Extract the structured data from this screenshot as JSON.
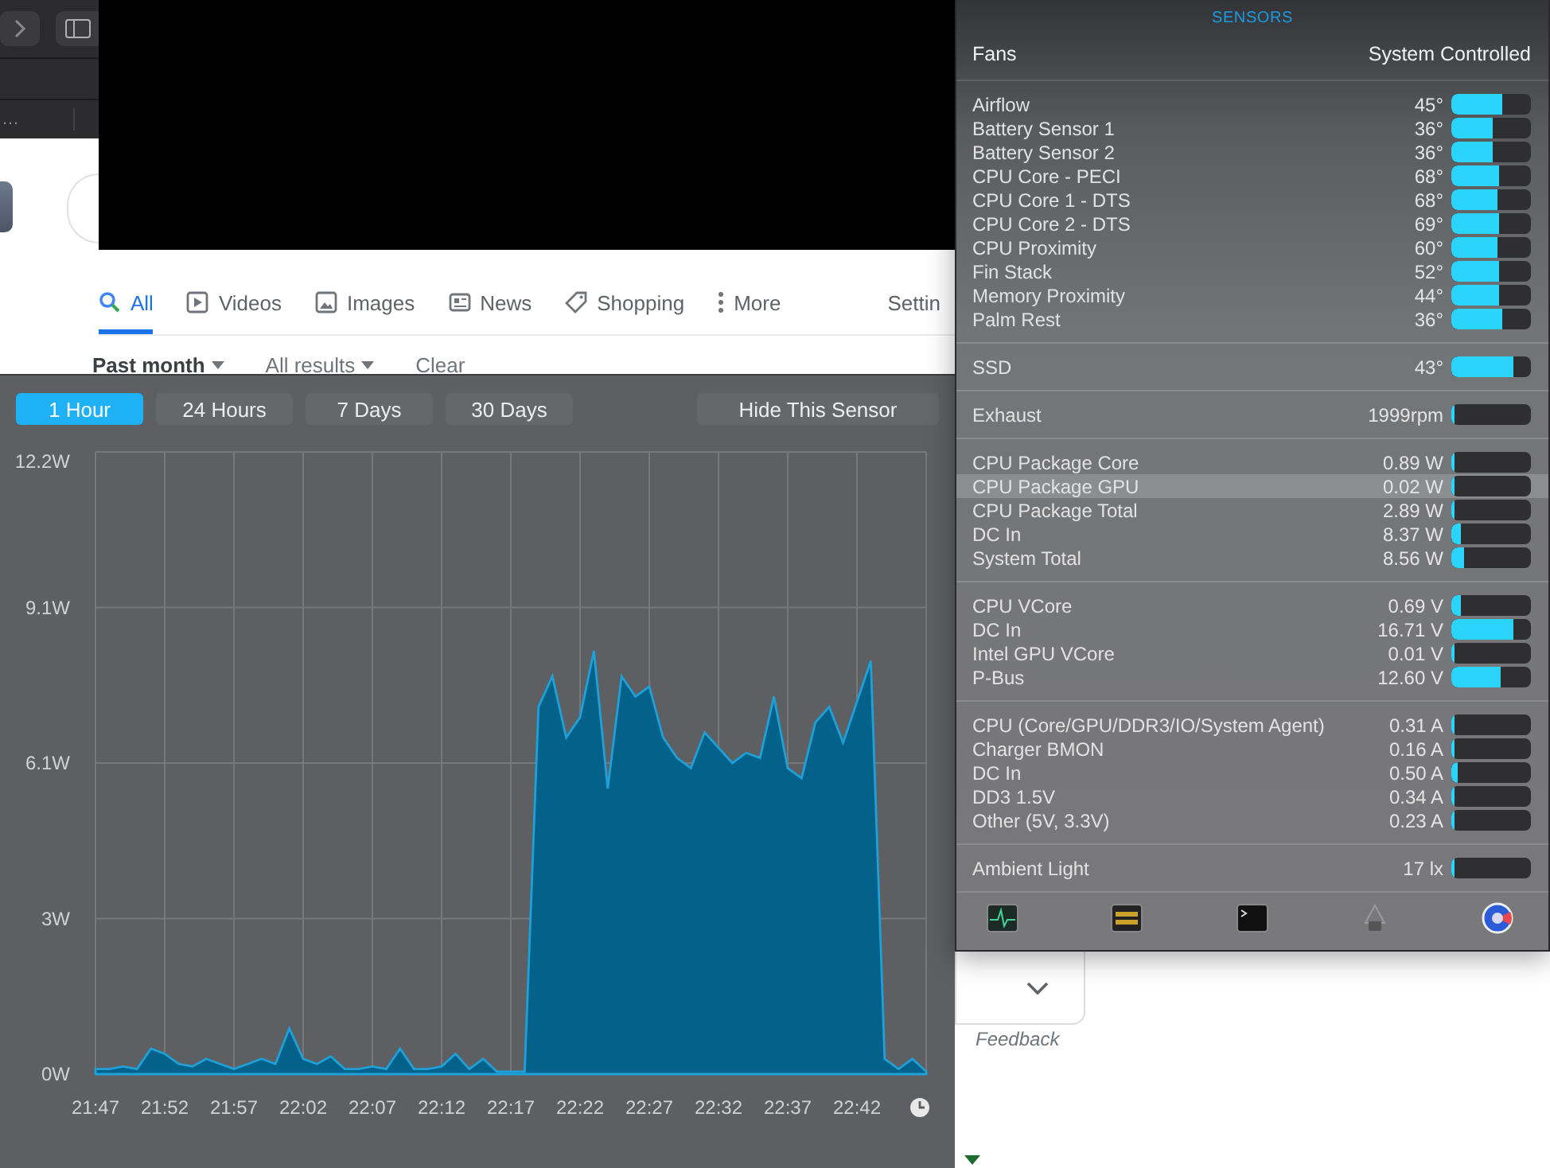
{
  "browser": {
    "tab_title": "…",
    "nav_tabs": [
      {
        "label": "All",
        "selected": true
      },
      {
        "label": "Videos",
        "selected": false
      },
      {
        "label": "Images",
        "selected": false
      },
      {
        "label": "News",
        "selected": false
      },
      {
        "label": "Shopping",
        "selected": false
      },
      {
        "label": "More",
        "selected": false
      },
      {
        "label": "Settin",
        "selected": false
      }
    ],
    "filters": [
      "Past month",
      "All results",
      "Clear"
    ],
    "feedback": "Feedback"
  },
  "history": {
    "ranges": [
      {
        "label": "1 Hour",
        "selected": true
      },
      {
        "label": "24 Hours",
        "selected": false
      },
      {
        "label": "7 Days",
        "selected": false
      },
      {
        "label": "30 Days",
        "selected": false
      }
    ],
    "hide_button": "Hide This Sensor",
    "chart_data": {
      "type": "area",
      "categories": [
        "21:47",
        null,
        null,
        null,
        null,
        "21:52",
        null,
        null,
        null,
        null,
        "21:57",
        null,
        null,
        null,
        null,
        "22:02",
        null,
        null,
        null,
        null,
        "22:07",
        null,
        null,
        null,
        null,
        "22:12",
        null,
        null,
        null,
        null,
        "22:17",
        null,
        null,
        null,
        null,
        "22:22",
        null,
        null,
        null,
        null,
        "22:27",
        null,
        null,
        null,
        null,
        "22:32",
        null,
        null,
        null,
        null,
        "22:37",
        null,
        null,
        null,
        null,
        "22:42",
        null,
        null,
        null,
        null,
        null
      ],
      "series": [
        {
          "color": "#1ea0d8",
          "values": [
            0.1,
            0.1,
            0.15,
            0.1,
            0.5,
            0.4,
            0.2,
            0.15,
            0.3,
            0.2,
            0.1,
            0.2,
            0.3,
            0.2,
            0.9,
            0.3,
            0.2,
            0.35,
            0.1,
            0.1,
            0.15,
            0.1,
            0.5,
            0.1,
            0.1,
            0.15,
            0.4,
            0.1,
            0.3,
            0.05,
            0.05,
            0.05,
            7.2,
            7.8,
            6.6,
            7.0,
            8.3,
            5.6,
            7.8,
            7.4,
            7.6,
            6.6,
            6.2,
            6.0,
            6.7,
            6.4,
            6.1,
            6.3,
            6.2,
            7.4,
            6.0,
            5.8,
            6.9,
            7.2,
            6.5,
            7.3,
            8.1,
            0.3,
            0.1,
            0.3,
            0.05
          ]
        }
      ],
      "ylim": [
        0,
        12.2
      ],
      "grid": true,
      "yticks": [
        {
          "value": 0,
          "label": "0W"
        },
        {
          "value": 3.05,
          "label": "3W"
        },
        {
          "value": 6.1,
          "label": "6.1W"
        },
        {
          "value": 9.15,
          "label": "9.1W"
        },
        {
          "value": 12.2,
          "label": "12.2W"
        }
      ]
    }
  },
  "sensors": {
    "title": "SENSORS",
    "fans": {
      "label": "Fans",
      "value": "System Controlled"
    },
    "groups": [
      {
        "rows": [
          {
            "name": "Airflow",
            "value": "45°",
            "level": 0.64,
            "selected": false
          },
          {
            "name": "Battery Sensor 1",
            "value": "36°",
            "level": 0.52,
            "selected": false
          },
          {
            "name": "Battery Sensor 2",
            "value": "36°",
            "level": 0.52,
            "selected": false
          },
          {
            "name": "CPU Core - PECI",
            "value": "68°",
            "level": 0.6,
            "selected": false
          },
          {
            "name": "CPU Core 1 - DTS",
            "value": "68°",
            "level": 0.58,
            "selected": false
          },
          {
            "name": "CPU Core 2 - DTS",
            "value": "69°",
            "level": 0.6,
            "selected": false
          },
          {
            "name": "CPU Proximity",
            "value": "60°",
            "level": 0.58,
            "selected": false
          },
          {
            "name": "Fin Stack",
            "value": "52°",
            "level": 0.6,
            "selected": false
          },
          {
            "name": "Memory Proximity",
            "value": "44°",
            "level": 0.6,
            "selected": false
          },
          {
            "name": "Palm Rest",
            "value": "36°",
            "level": 0.64,
            "selected": false
          }
        ]
      },
      {
        "rows": [
          {
            "name": "SSD",
            "value": "43°",
            "level": 0.78,
            "selected": false
          }
        ]
      },
      {
        "rows": [
          {
            "name": "Exhaust",
            "value": "1999rpm",
            "level": 0,
            "selected": false
          }
        ]
      },
      {
        "rows": [
          {
            "name": "CPU Package Core",
            "value": "0.89 W",
            "level": 0.02,
            "selected": false
          },
          {
            "name": "CPU Package GPU",
            "value": "0.02 W",
            "level": 0.01,
            "selected": true
          },
          {
            "name": "CPU Package Total",
            "value": "2.89 W",
            "level": 0.02,
            "selected": false
          },
          {
            "name": "DC In",
            "value": "8.37 W",
            "level": 0.12,
            "selected": false
          },
          {
            "name": "System Total",
            "value": "8.56 W",
            "level": 0.16,
            "selected": false
          }
        ]
      },
      {
        "rows": [
          {
            "name": "CPU VCore",
            "value": "0.69 V",
            "level": 0.12,
            "selected": false
          },
          {
            "name": "DC In",
            "value": "16.71 V",
            "level": 0.78,
            "selected": false
          },
          {
            "name": "Intel GPU VCore",
            "value": "0.01 V",
            "level": 0.01,
            "selected": false
          },
          {
            "name": "P-Bus",
            "value": "12.60 V",
            "level": 0.62,
            "selected": false
          }
        ]
      },
      {
        "rows": [
          {
            "name": "CPU (Core/GPU/DDR3/IO/System Agent)",
            "value": "0.31 A",
            "level": 0.02,
            "selected": false
          },
          {
            "name": "Charger BMON",
            "value": "0.16 A",
            "level": 0.02,
            "selected": false
          },
          {
            "name": "DC In",
            "value": "0.50 A",
            "level": 0.08,
            "selected": false
          },
          {
            "name": "DD3 1.5V",
            "value": "0.34 A",
            "level": 0.02,
            "selected": false
          },
          {
            "name": "Other (5V, 3.3V)",
            "value": "0.23 A",
            "level": 0.02,
            "selected": false
          }
        ]
      },
      {
        "rows": [
          {
            "name": "Ambient Light",
            "value": "17 lx",
            "level": 0.02,
            "selected": false
          }
        ]
      }
    ]
  }
}
